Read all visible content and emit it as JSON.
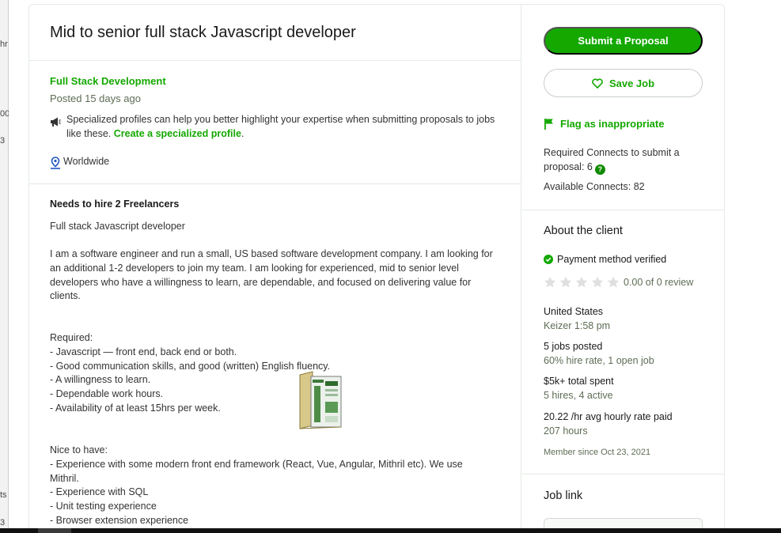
{
  "background_strip": [
    "hr",
    "00",
    "3",
    "ts",
    "3"
  ],
  "job": {
    "title": "Mid to senior full stack Javascript developer",
    "category": "Full Stack Development",
    "posted": "Posted 15 days ago",
    "specialized_text": "Specialized profiles can help you better highlight your expertise when submitting proposals to jobs like these. ",
    "specialized_link": "Create a specialized profile",
    "specialized_suffix": ".",
    "location": "Worldwide"
  },
  "description": {
    "hire_heading": "Needs to hire 2 Freelancers",
    "line1": "Full stack Javascript developer",
    "paragraph": "I am a software engineer and run a small, US based software development company. I am looking for an additional 1-2 developers to join my team. I am looking for experienced, mid to senior level developers who have a willingness to learn, are dependable, and focused on delivering value for clients.",
    "required_heading": "Required:",
    "required": [
      "- Javascript — front end, back end or both.",
      "- Good communication skills, and good (written) English fluency.",
      "- A willingness to learn.",
      "- Dependable work hours.",
      "- Availability of at least 15hrs per week."
    ],
    "nice_heading": "Nice to have:",
    "nice_first": "- Experience with some modern front end framework (React, Vue, Angular, Mithril etc). We use Mithril.",
    "nice": [
      "- Experience with SQL",
      "- Unit testing experience",
      "- Browser extension experience"
    ]
  },
  "sidebar": {
    "submit_label": "Submit a Proposal",
    "save_label": "Save Job",
    "flag_label": "Flag as inappropriate",
    "connects_required": "Required Connects to submit a proposal: 6",
    "connects_available": "Available Connects: 82",
    "accent_color": "#14a800"
  },
  "client": {
    "heading": "About the client",
    "payment": "Payment method verified",
    "rating_value": 0,
    "rating_max": 5,
    "rating_text": "0.00 of 0 review",
    "country": "United States",
    "local_time": "Keizer 1:58 pm",
    "jobs_posted": "5 jobs posted",
    "hire_rate": "60% hire rate, 1 open job",
    "total_spent": "$5k+ total spent",
    "hires": "5 hires, 4 active",
    "avg_rate": "20.22 /hr avg hourly rate paid",
    "hours": "207 hours",
    "member_since": "Member since Oct 23, 2021"
  },
  "job_link": {
    "heading": "Job link"
  }
}
